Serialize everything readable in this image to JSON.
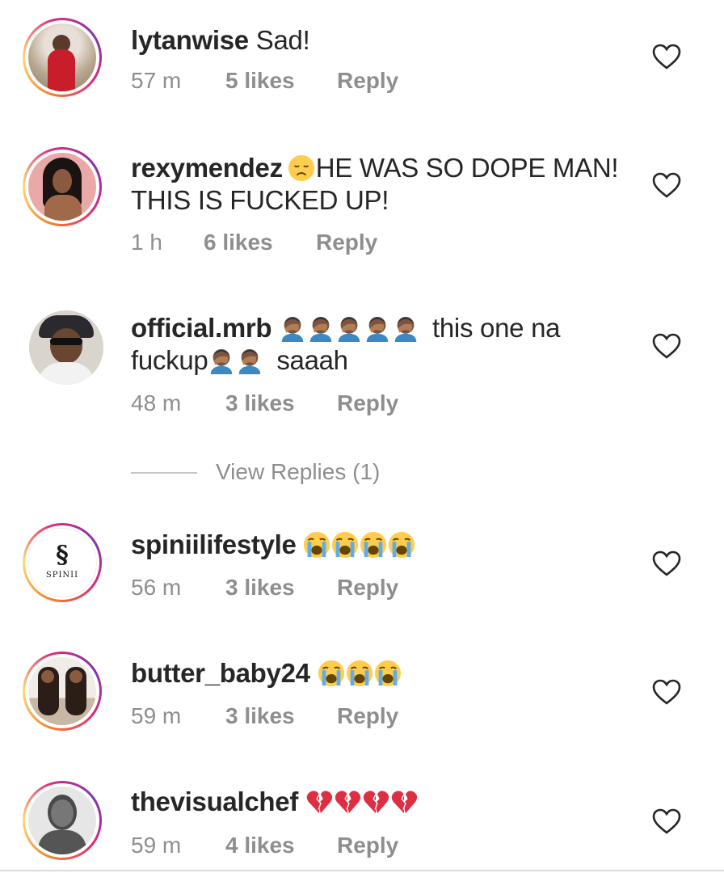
{
  "comments": [
    {
      "username": "lytanwise",
      "text": "Sad!",
      "time": "57 m",
      "likes": "5 likes",
      "reply": "Reply"
    },
    {
      "username": "rexymendez",
      "text": "HE WAS SO DOPE MAN!",
      "text2": "THIS IS FUCKED UP!",
      "time": "1 h",
      "likes": "6 likes",
      "reply": "Reply"
    },
    {
      "username": "official.mrb",
      "text": "this one na",
      "text2a": "fuckup",
      "text2b": "saaah",
      "time": "48 m",
      "likes": "3 likes",
      "reply": "Reply"
    },
    {
      "username": "spiniilifestyle",
      "avatar_text": "SPINII",
      "time": "56 m",
      "likes": "3 likes",
      "reply": "Reply"
    },
    {
      "username": "butter_baby24",
      "time": "59 m",
      "likes": "3 likes",
      "reply": "Reply"
    },
    {
      "username": "thevisualchef",
      "time": "59 m",
      "likes": "4 likes",
      "reply": "Reply"
    }
  ],
  "view_replies": "View Replies (1)",
  "icons": {
    "like": "heart-outline-icon",
    "disappointed": "disappointed-face-emoji",
    "facepalm": "man-facepalming-emoji",
    "crying": "loudly-crying-face-emoji",
    "broken_heart": "broken-heart-emoji"
  },
  "colors": {
    "text": "#262626",
    "secondary": "#8e8e8e",
    "story_ring": [
      "#f58529",
      "#feda77",
      "#dd2a7b",
      "#8134af"
    ]
  }
}
